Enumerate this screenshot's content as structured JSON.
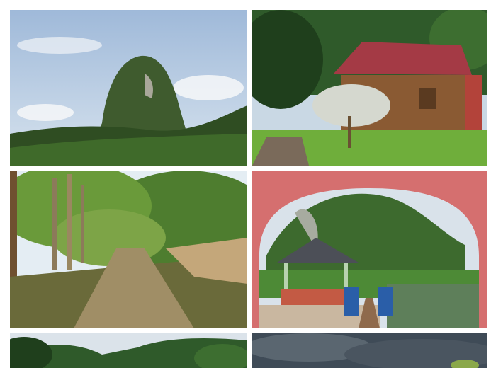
{
  "collage": {
    "photos": [
      {
        "subject": "limestone-hill-with-palm-plantation"
      },
      {
        "subject": "red-roof-wooden-chalet"
      },
      {
        "subject": "dirt-path-through-trees"
      },
      {
        "subject": "arch-view-gazebo-by-lake"
      },
      {
        "subject": "forested-hills-sky"
      },
      {
        "subject": "cloudy-sky"
      }
    ]
  }
}
